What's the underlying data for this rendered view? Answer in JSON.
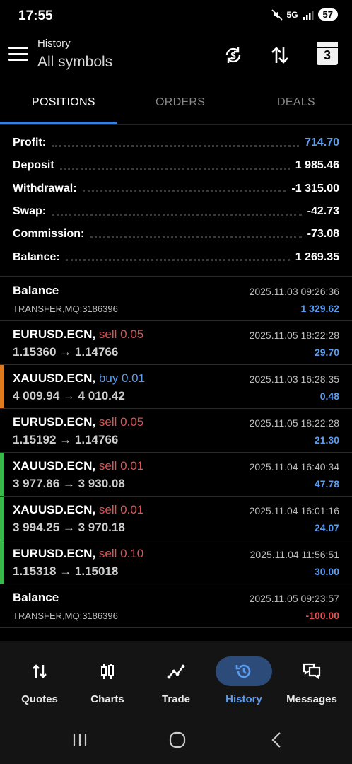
{
  "status_bar": {
    "time": "17:55",
    "signal_label": "5G",
    "battery": "57"
  },
  "header": {
    "subtitle": "History",
    "title": "All symbols",
    "calendar_day": "3",
    "icons": [
      "menu-icon",
      "currency-sync-icon",
      "sort-icon",
      "calendar-icon"
    ]
  },
  "tabs": [
    {
      "label": "POSITIONS",
      "active": true
    },
    {
      "label": "ORDERS",
      "active": false
    },
    {
      "label": "DEALS",
      "active": false
    }
  ],
  "summary": [
    {
      "label": "Profit:",
      "value": "714.70",
      "accent": true
    },
    {
      "label": "Deposit",
      "value": "1 985.46",
      "accent": false
    },
    {
      "label": "Withdrawal:",
      "value": "-1 315.00",
      "accent": false
    },
    {
      "label": "Swap:",
      "value": "-42.73",
      "accent": false
    },
    {
      "label": "Commission:",
      "value": "-73.08",
      "accent": false
    },
    {
      "label": "Balance:",
      "value": "1 269.35",
      "accent": false
    }
  ],
  "deals": [
    {
      "symbol": "Balance",
      "side": "",
      "side_type": "",
      "sub": "TRANSFER,MQ:3186396",
      "sub_type": "comment",
      "time": "2025.11.03 09:26:36",
      "profit": "1 329.62",
      "profit_type": "pos",
      "edge": ""
    },
    {
      "symbol": "EURUSD.ECN,",
      "side": "sell 0.05",
      "side_type": "sell",
      "sub": "1.15360 → 1.14766",
      "sub_type": "prices",
      "time": "2025.11.05 18:22:28",
      "profit": "29.70",
      "profit_type": "pos",
      "edge": ""
    },
    {
      "symbol": "XAUUSD.ECN,",
      "side": "buy 0.01",
      "side_type": "buy",
      "sub": "4 009.94 → 4 010.42",
      "sub_type": "prices",
      "time": "2025.11.03 16:28:35",
      "profit": "0.48",
      "profit_type": "pos",
      "edge": "#e07a1f"
    },
    {
      "symbol": "EURUSD.ECN,",
      "side": "sell 0.05",
      "side_type": "sell",
      "sub": "1.15192 → 1.14766",
      "sub_type": "prices",
      "time": "2025.11.05 18:22:28",
      "profit": "21.30",
      "profit_type": "pos",
      "edge": ""
    },
    {
      "symbol": "XAUUSD.ECN,",
      "side": "sell 0.01",
      "side_type": "sell",
      "sub": "3 977.86 → 3 930.08",
      "sub_type": "prices",
      "time": "2025.11.04 16:40:34",
      "profit": "47.78",
      "profit_type": "pos",
      "edge": "#3cb84a"
    },
    {
      "symbol": "XAUUSD.ECN,",
      "side": "sell 0.01",
      "side_type": "sell",
      "sub": "3 994.25 → 3 970.18",
      "sub_type": "prices",
      "time": "2025.11.04 16:01:16",
      "profit": "24.07",
      "profit_type": "pos",
      "edge": "#3cb84a"
    },
    {
      "symbol": "EURUSD.ECN,",
      "side": "sell 0.10",
      "side_type": "sell",
      "sub": "1.15318 → 1.15018",
      "sub_type": "prices",
      "time": "2025.11.04 11:56:51",
      "profit": "30.00",
      "profit_type": "pos",
      "edge": "#3cb84a"
    },
    {
      "symbol": "Balance",
      "side": "",
      "side_type": "",
      "sub": "TRANSFER,MQ:3186396",
      "sub_type": "comment",
      "time": "2025.11.05 09:23:57",
      "profit": "-100.00",
      "profit_type": "neg",
      "edge": ""
    }
  ],
  "bottom_nav": [
    {
      "label": "Quotes",
      "icon": "quotes-icon",
      "active": false
    },
    {
      "label": "Charts",
      "icon": "charts-icon",
      "active": false
    },
    {
      "label": "Trade",
      "icon": "trade-icon",
      "active": false
    },
    {
      "label": "History",
      "icon": "history-icon",
      "active": true
    },
    {
      "label": "Messages",
      "icon": "messages-icon",
      "active": false
    }
  ],
  "colors": {
    "accent_blue": "#5b9cf0",
    "sell_red": "#e05252",
    "buy_edge_orange": "#e07a1f",
    "sell_edge_green": "#3cb84a",
    "background": "#000000"
  }
}
